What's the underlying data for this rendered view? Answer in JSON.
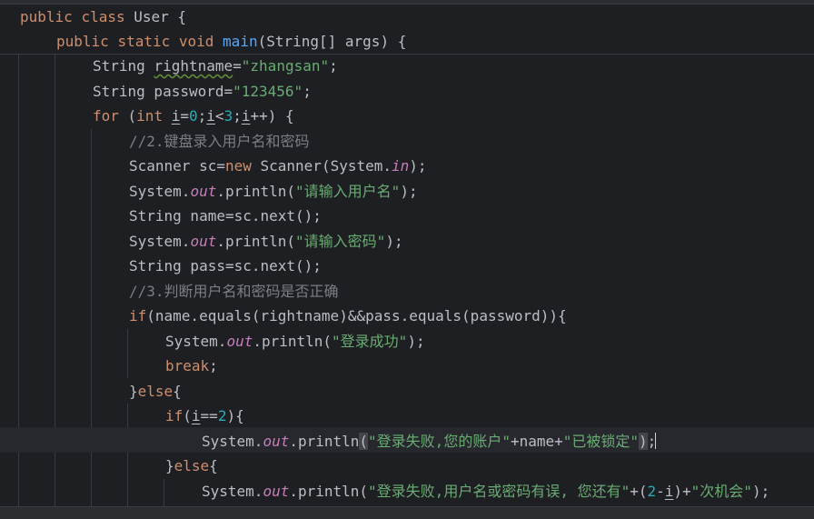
{
  "editor": {
    "lines": [
      [
        "public class User {"
      ],
      [
        "public static void main(String[] args) {"
      ],
      [
        "String rightname=\"zhangsan\";"
      ],
      [
        "String password=\"123456\";"
      ],
      [
        "for (int i=0;i<3;i++) {"
      ],
      [
        "//2.键盘录入用户名和密码"
      ],
      [
        "Scanner sc=new Scanner(System.in);"
      ],
      [
        "System.out.println(\"请输入用户名\");"
      ],
      [
        "String name=sc.next();"
      ],
      [
        "System.out.println(\"请输入密码\");"
      ],
      [
        "String pass=sc.next();"
      ],
      [
        "//3.判断用户名和密码是否正确"
      ],
      [
        "if(name.equals(rightname)&&pass.equals(password)){"
      ],
      [
        "System.out.println(\"登录成功\");"
      ],
      [
        "break;"
      ],
      [
        "}else{"
      ],
      [
        "if(i==2){"
      ],
      [
        "System.out.println(\"登录失败,您的账户\"+name+\"已被锁定\");"
      ],
      [
        "}else{"
      ],
      [
        "System.out.println(\"登录失败,用户名或密码有误, 您还有\"+(2-i)+\"次机会\");"
      ]
    ],
    "tokens": {
      "l0": [
        "public",
        "class",
        "User",
        "{"
      ],
      "l1": [
        "public",
        "static",
        "void",
        "main",
        "(String[] args) {"
      ],
      "l2": [
        "String ",
        "rightname",
        "=",
        "\"zhangsan\"",
        ";"
      ],
      "l3": [
        "String password=",
        "\"123456\"",
        ";"
      ],
      "l4": [
        "for",
        " (",
        "int",
        " ",
        "i",
        "=",
        "0",
        ";",
        "i",
        "<",
        "3",
        ";",
        "i",
        "++) {"
      ],
      "l5": [
        "//2.键盘录入用户名和密码"
      ],
      "l6": [
        "Scanner sc=",
        "new",
        " Scanner(System.",
        "in",
        ");"
      ],
      "l7": [
        "System.",
        "out",
        ".println(",
        "\"请输入用户名\"",
        ");"
      ],
      "l8": [
        "String name=sc.next();"
      ],
      "l9": [
        "System.",
        "out",
        ".println(",
        "\"请输入密码\"",
        ");"
      ],
      "l10": [
        "String pass=sc.next();"
      ],
      "l11": [
        "//3.判断用户名和密码是否正确"
      ],
      "l12": [
        "if",
        "(name.equals(rightname)&&pass.equals(password)){"
      ],
      "l13": [
        "System.",
        "out",
        ".println(",
        "\"登录成功\"",
        ");"
      ],
      "l14": [
        "break",
        ";"
      ],
      "l15": [
        "}",
        "else",
        "{"
      ],
      "l16": [
        "if",
        "(",
        "i",
        "==",
        "2",
        "){"
      ],
      "l17": [
        "System.",
        "out",
        ".println",
        "(",
        "\"登录失败,您的账户\"",
        "+name+",
        "\"已被锁定\"",
        ")",
        ";"
      ],
      "l18": [
        "}",
        "else",
        "{"
      ],
      "l19": [
        "System.",
        "out",
        ".println(",
        "\"登录失败,用户名或密码有误, 您还有\"",
        "+(",
        "2",
        "-",
        "i",
        ")+",
        "\"次机会\"",
        ");"
      ]
    }
  },
  "theme": {
    "background": "#1e1f22",
    "text": "#bcbec4",
    "keyword": "#cf8e6d",
    "function": "#56a8f5",
    "string": "#6aab73",
    "number": "#2aacb8",
    "comment": "#7a7e85",
    "static_field": "#c77dbb",
    "current_line": "#26282e"
  }
}
